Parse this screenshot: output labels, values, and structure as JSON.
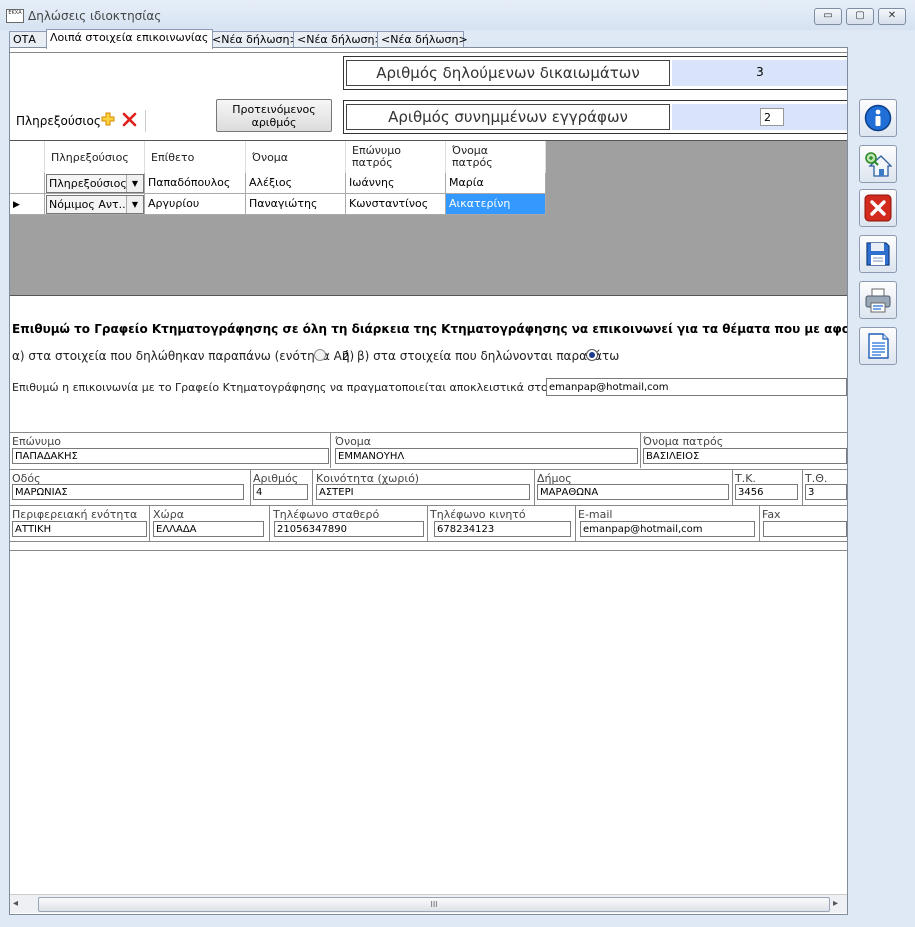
{
  "window": {
    "title": "Δηλώσεις ιδιοκτησίας",
    "icon_text": "ΕΚΧΑ",
    "minimize": "▭",
    "maximize": "▢",
    "close": "✕"
  },
  "tabs": [
    {
      "label": "ΟΤΑ",
      "active": false
    },
    {
      "label": "Λοιπά στοιχεία επικοινωνίας",
      "active": true
    },
    {
      "label": "<Νέα δήλωση>",
      "active": false
    },
    {
      "label": "<Νέα δήλωση>",
      "active": false
    },
    {
      "label": "<Νέα δήλωση>",
      "active": false
    }
  ],
  "counts": {
    "rights_label": "Αριθμός δηλούμενων δικαιωμάτων",
    "rights_value": "3",
    "docs_label": "Αριθμός συνημμένων εγγράφων",
    "docs_value": "2"
  },
  "proxies": {
    "label": "Πληρεξούσιος",
    "suggested_button": "Προτεινόμενος\nαριθμός",
    "columns": [
      "Πληρεξούσιος",
      "Επίθετο",
      "Όνομα",
      "Επώνυμο\nπατρός",
      "Όνομα\nπατρός"
    ],
    "rows": [
      {
        "type": "Πληρεξούσιος",
        "surname": "Παπαδόπουλος",
        "name": "Αλέξιος",
        "father_surname": "Ιωάννης",
        "father_name": "Μαρία",
        "current": false
      },
      {
        "type": "Νόμιμος Αντ...",
        "surname": "Αργυρίου",
        "name": "Παναγιώτης",
        "father_surname": "Κωνσταντίνος",
        "father_name": "Αικατερίνη",
        "current": true
      }
    ]
  },
  "contact": {
    "heading": "Επιθυμώ το Γραφείο Κτηματογράφησης σε όλη τη διάρκεια της Κτηματογράφησης να επικοινωνεί για τα θέματα που με αφορούν:",
    "option_a": "α) στα στοιχεία που δηλώθηκαν παραπάνω (ενότητα Α2)",
    "or_text": "ή",
    "option_b": "β) στα στοιχεία που δηλώνονται παρακάτω",
    "selected_option": "b",
    "email_only_label": "Επιθυμώ η επικοινωνία με το Γραφείο Κτηματογράφησης να πραγματοποιείται αποκλειστικά στο e-mail",
    "email_only_value": "emanpap@hotmail,com"
  },
  "person": {
    "surname_label": "Επώνυμο",
    "surname": "ΠΑΠΑΔΑΚΗΣ",
    "name_label": "Όνομα",
    "name": "ΕΜΜΑΝΟΥΗΛ",
    "father_label": "Όνομα πατρός",
    "father": "ΒΑΣΙΛΕΙΟΣ",
    "street_label": "Οδός",
    "street": "ΜΑΡΩΝΙΑΣ",
    "number_label": "Αριθμός",
    "number": "4",
    "community_label": "Κοινότητα (χωριό)",
    "community": "ΑΣΤΕΡΙ",
    "municipality_label": "Δήμος",
    "municipality": "ΜΑΡΑΘΩΝΑ",
    "tk_label": "Τ.Κ.",
    "tk": "3456",
    "to_label": "Τ.Θ.",
    "to": "3",
    "region_label": "Περιφερειακή ενότητα",
    "region": "ΑΤΤΙΚΗ",
    "country_label": "Χώρα",
    "country": "ΕΛΛΑΔΑ",
    "phone_label": "Τηλέφωνο σταθερό",
    "phone": "21056347890",
    "mobile_label": "Τηλέφωνο κινητό",
    "mobile": "678234123",
    "email_label": "E-mail",
    "email": "emanpap@hotmail,com",
    "fax_label": "Fax",
    "fax": ""
  },
  "scrollbar": {
    "left": "◂",
    "right": "▸",
    "grip": "III"
  },
  "colors": {
    "selection": "#3399ff",
    "count_bg": "#d9e4fb",
    "grid_bg": "#a0a0a0"
  }
}
